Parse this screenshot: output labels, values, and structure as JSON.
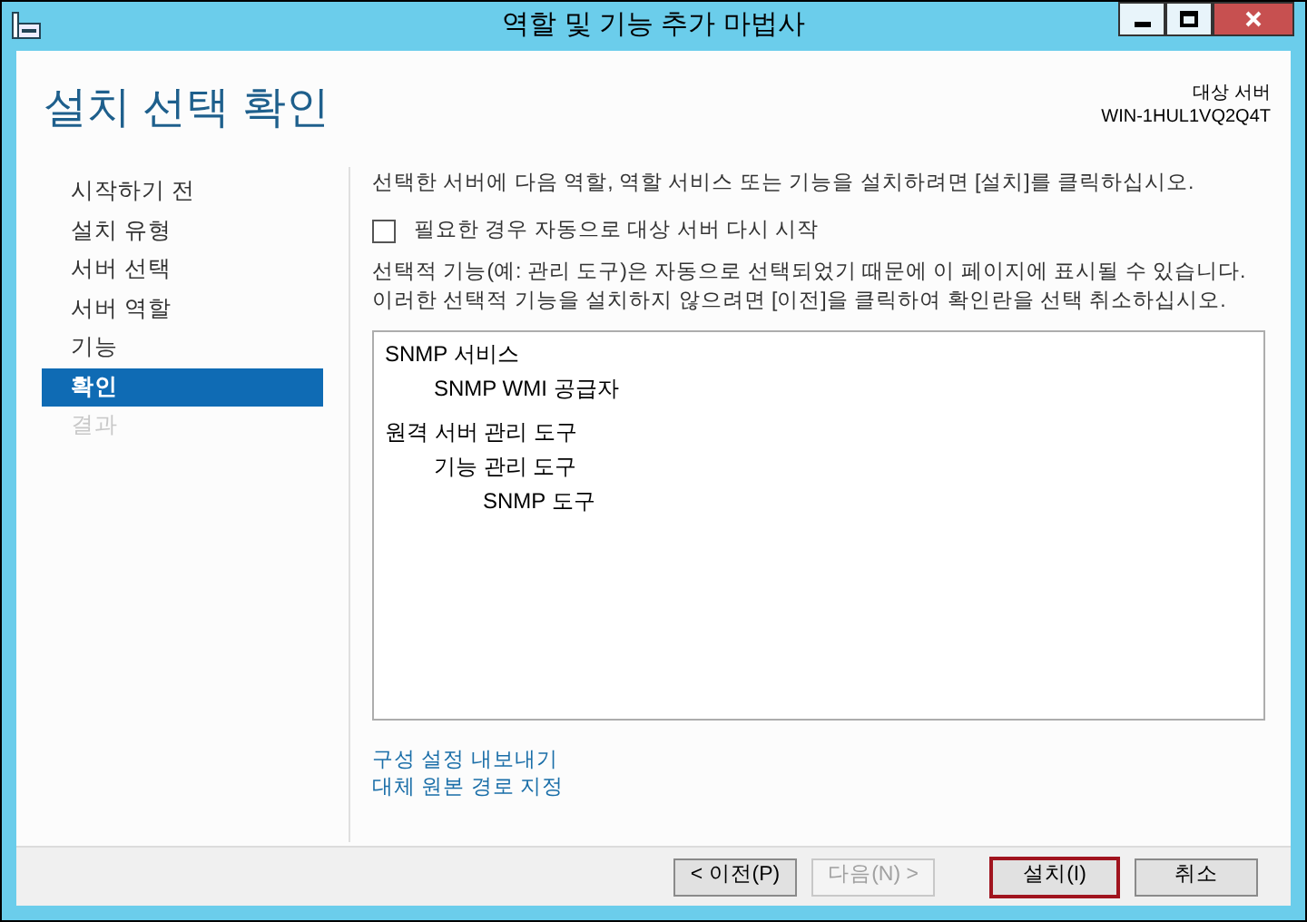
{
  "window": {
    "title": "역할 및 기능 추가 마법사"
  },
  "header": {
    "title": "설치 선택 확인",
    "target_label": "대상 서버",
    "target_server": "WIN-1HUL1VQ2Q4T"
  },
  "sidebar": {
    "items": [
      {
        "label": "시작하기 전",
        "selected": false,
        "disabled": false
      },
      {
        "label": "설치 유형",
        "selected": false,
        "disabled": false
      },
      {
        "label": "서버 선택",
        "selected": false,
        "disabled": false
      },
      {
        "label": "서버 역할",
        "selected": false,
        "disabled": false
      },
      {
        "label": "기능",
        "selected": false,
        "disabled": false
      },
      {
        "label": "확인",
        "selected": true,
        "disabled": false
      },
      {
        "label": "결과",
        "selected": false,
        "disabled": true
      }
    ]
  },
  "main": {
    "intro": "선택한 서버에 다음 역할, 역할 서비스 또는 기능을 설치하려면 [설치]를 클릭하십시오.",
    "restart_option": {
      "label": "필요한 경우 자동으로 대상 서버 다시 시작",
      "checked": false
    },
    "note": "선택적 기능(예: 관리 도구)은 자동으로 선택되었기 때문에 이 페이지에 표시될 수 있습니다. 이러한 선택적 기능을 설치하지 않으려면 [이전]을 클릭하여 확인란을 선택 취소하십시오.",
    "tree": [
      {
        "label": "SNMP 서비스",
        "children": [
          {
            "label": "SNMP WMI 공급자"
          }
        ]
      },
      {
        "label": "원격 서버 관리 도구",
        "children": [
          {
            "label": "기능 관리 도구",
            "children": [
              {
                "label": "SNMP 도구"
              }
            ]
          }
        ]
      }
    ],
    "links": [
      "구성 설정 내보내기",
      "대체 원본 경로 지정"
    ]
  },
  "buttons": [
    {
      "label": "< 이전(P)",
      "disabled": false,
      "default": false
    },
    {
      "label": "다음(N) >",
      "disabled": true,
      "default": false
    },
    {
      "label": "설치(I)",
      "disabled": false,
      "default": true
    },
    {
      "label": "취소",
      "disabled": false,
      "default": false
    }
  ]
}
